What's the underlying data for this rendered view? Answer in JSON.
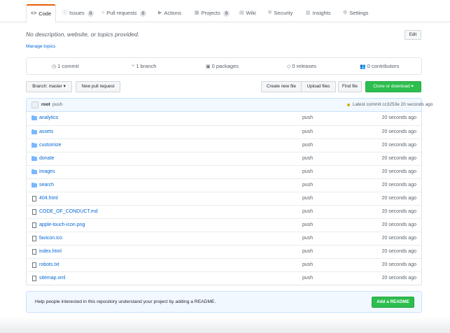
{
  "tabs": [
    {
      "label": "Code",
      "icon": "code-icon",
      "glyph": "<>",
      "counter": ""
    },
    {
      "label": "Issues",
      "icon": "issue-icon",
      "glyph": "ⓘ",
      "counter": "0"
    },
    {
      "label": "Pull requests",
      "icon": "pull-request-icon",
      "glyph": "⑂",
      "counter": "0"
    },
    {
      "label": "Actions",
      "icon": "play-icon",
      "glyph": "▶",
      "counter": ""
    },
    {
      "label": "Projects",
      "icon": "project-icon",
      "glyph": "▦",
      "counter": "0"
    },
    {
      "label": "Wiki",
      "icon": "book-icon",
      "glyph": "▤",
      "counter": ""
    },
    {
      "label": "Security",
      "icon": "shield-icon",
      "glyph": "⛨",
      "counter": ""
    },
    {
      "label": "Insights",
      "icon": "graph-icon",
      "glyph": "▥",
      "counter": ""
    },
    {
      "label": "Settings",
      "icon": "gear-icon",
      "glyph": "⚙",
      "counter": ""
    }
  ],
  "repo": {
    "description": "No description, website, or topics provided.",
    "edit_label": "Edit",
    "manage_topics": "Manage topics"
  },
  "numbers": [
    {
      "text": "1 commit",
      "icon": "history-icon",
      "glyph": "◷"
    },
    {
      "text": "1 branch",
      "icon": "branch-icon",
      "glyph": "⑂"
    },
    {
      "text": "0 packages",
      "icon": "package-icon",
      "glyph": "▣"
    },
    {
      "text": "0 releases",
      "icon": "tag-icon",
      "glyph": "◇"
    },
    {
      "text": "0 contributors",
      "icon": "people-icon",
      "glyph": "👥"
    }
  ],
  "toolbar": {
    "branch_label": "Branch: master ▾",
    "new_pr": "New pull request",
    "create_file": "Create new file",
    "upload_files": "Upload files",
    "find_file": "Find file",
    "clone": "Clone or download ▾"
  },
  "commit": {
    "user": "root",
    "message": "push",
    "latest": "Latest commit cc3253e 20 seconds ago",
    "status_color": "#dbab09"
  },
  "files": [
    {
      "name": "analytics",
      "type": "dir",
      "message": "push",
      "age": "20 seconds ago"
    },
    {
      "name": "assets",
      "type": "dir",
      "message": "push",
      "age": "20 seconds ago"
    },
    {
      "name": "customize",
      "type": "dir",
      "message": "push",
      "age": "20 seconds ago"
    },
    {
      "name": "donate",
      "type": "dir",
      "message": "push",
      "age": "20 seconds ago"
    },
    {
      "name": "images",
      "type": "dir",
      "message": "push",
      "age": "20 seconds ago"
    },
    {
      "name": "search",
      "type": "dir",
      "message": "push",
      "age": "20 seconds ago"
    },
    {
      "name": "404.html",
      "type": "file",
      "message": "push",
      "age": "20 seconds ago"
    },
    {
      "name": "CODE_OF_CONDUCT.md",
      "type": "file",
      "message": "push",
      "age": "20 seconds ago"
    },
    {
      "name": "apple-touch-icon.png",
      "type": "file",
      "message": "push",
      "age": "20 seconds ago"
    },
    {
      "name": "favicon.ico",
      "type": "file",
      "message": "push",
      "age": "20 seconds ago"
    },
    {
      "name": "index.html",
      "type": "file",
      "message": "push",
      "age": "20 seconds ago"
    },
    {
      "name": "robots.txt",
      "type": "file",
      "message": "push",
      "age": "20 seconds ago"
    },
    {
      "name": "sitemap.xml",
      "type": "file",
      "message": "push",
      "age": "20 seconds ago"
    }
  ],
  "readme": {
    "text": "Help people interested in this repository understand your project by adding a README.",
    "button": "Add a README"
  },
  "colors": {
    "accent_green": "#2cbe4e",
    "link_blue": "#0366d6",
    "tab_orange": "#e36209",
    "folder_blue": "#79b8ff"
  }
}
